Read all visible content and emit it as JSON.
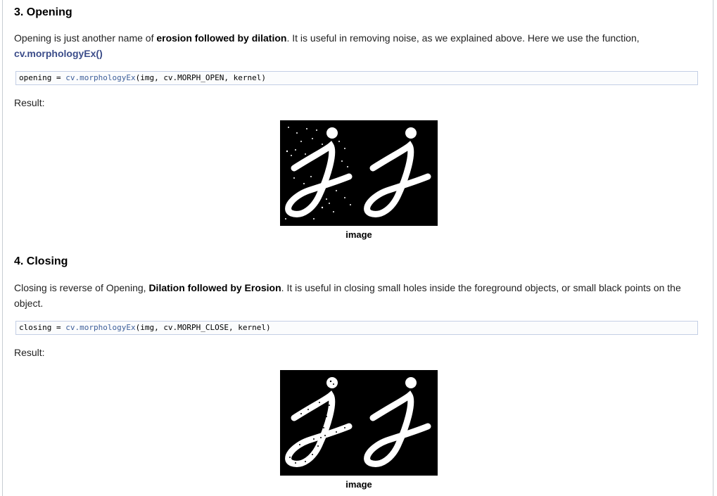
{
  "opening": {
    "heading": "3. Opening",
    "text_1": "Opening is just another name of ",
    "text_bold": "erosion followed by dilation",
    "text_2": ". It is useful in removing noise, as we explained above. Here we use the function,",
    "function_link": "cv.morphologyEx()",
    "code": {
      "var": "opening = ",
      "fn": "cv.morphologyEx",
      "args": "(img, cv.MORPH_OPEN, kernel)"
    },
    "result_label": "Result:",
    "caption": "image"
  },
  "closing": {
    "heading": "4. Closing",
    "text_1": "Closing is reverse of Opening, ",
    "text_bold": "Dilation followed by Erosion",
    "text_2": ". It is useful in closing small holes inside the foreground objects, or small black points on the object.",
    "code": {
      "var": "closing = ",
      "fn": "cv.morphologyEx",
      "args": "(img, cv.MORPH_CLOSE, kernel)"
    },
    "result_label": "Result:",
    "caption": "image"
  }
}
